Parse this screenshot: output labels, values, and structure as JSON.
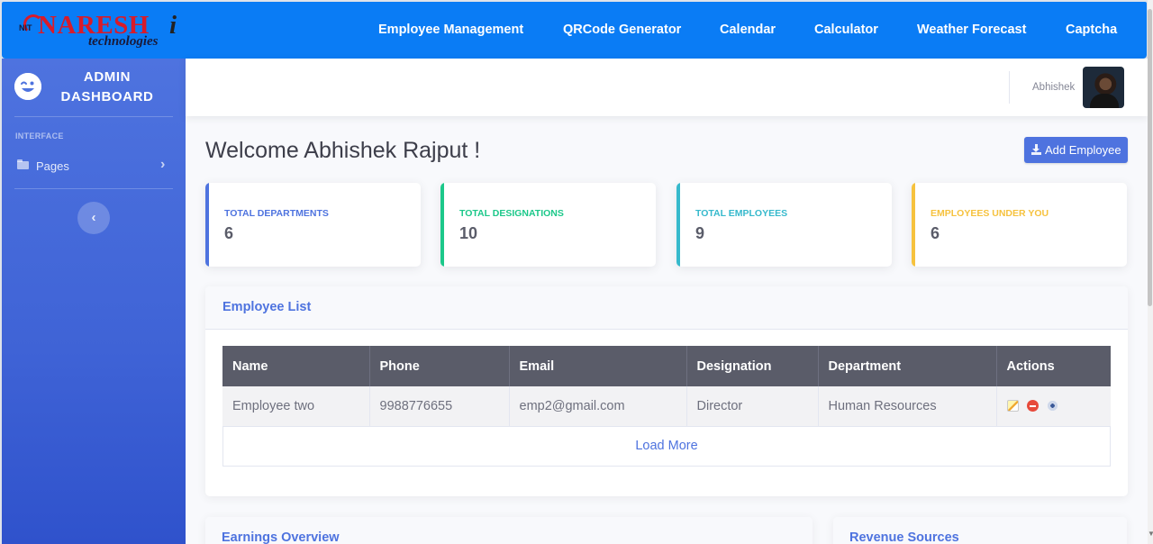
{
  "logo": {
    "nit": "NIT",
    "brand": "NARESH",
    "brand_i": "i",
    "sub": "technologies"
  },
  "topnav": {
    "links": [
      {
        "label": "Employee Management"
      },
      {
        "label": "QRCode Generator"
      },
      {
        "label": "Calendar"
      },
      {
        "label": "Calculator"
      },
      {
        "label": "Weather Forecast"
      },
      {
        "label": "Captcha"
      }
    ]
  },
  "sidebar": {
    "brand_icon": "laugh-wink-icon",
    "brand_line1": "ADMIN",
    "brand_line2": "DASHBOARD",
    "heading": "INTERFACE",
    "item_label": "Pages",
    "toggle_glyph": "‹"
  },
  "topbar": {
    "user_name": "Abhishek"
  },
  "page": {
    "welcome": "Welcome Abhishek Rajput !",
    "add_button": "Add Employee"
  },
  "cards": [
    {
      "label": "Total Departments",
      "value": "6",
      "color": "#4e73df"
    },
    {
      "label": "Total Designations",
      "value": "10",
      "color": "#1cc88a"
    },
    {
      "label": "Total Employees",
      "value": "9",
      "color": "#36b9cc"
    },
    {
      "label": "Employees Under You",
      "value": "6",
      "color": "#f6c23e"
    }
  ],
  "employee_list": {
    "title": "Employee List",
    "columns": [
      "Name",
      "Phone",
      "Email",
      "Designation",
      "Department",
      "Actions"
    ],
    "rows": [
      {
        "name": "Employee two",
        "phone": "9988776655",
        "email": "emp2@gmail.com",
        "designation": "Director",
        "department": "Human Resources"
      }
    ],
    "load_more": "Load More"
  },
  "lower_panels": {
    "earnings": "Earnings Overview",
    "revenue": "Revenue Sources"
  }
}
